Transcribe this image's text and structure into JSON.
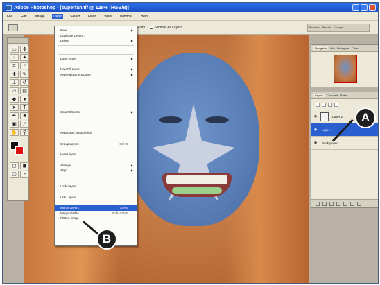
{
  "window": {
    "title": "Adobe Photoshop - [superfan.tif @ 128% (RGB/8)]"
  },
  "menubar": {
    "items": [
      "File",
      "Edit",
      "Image",
      "Layer",
      "Select",
      "Filter",
      "View",
      "Window",
      "Help"
    ],
    "active": "Layer"
  },
  "options_bar": {
    "opacity_label": "Opacity",
    "sample_label": "Sample All Layers",
    "well_tabs": [
      "Brushes",
      "Presets",
      "Comps"
    ]
  },
  "layer_menu": {
    "items": [
      {
        "label": "New",
        "submenu": true
      },
      {
        "label": "Duplicate Layers...",
        "submenu": false
      },
      {
        "label": "Delete",
        "submenu": true
      },
      {
        "label": "Layer Style",
        "submenu": true
      },
      {
        "label": "New Fill Layer",
        "submenu": true
      },
      {
        "label": "New Adjustment Layer",
        "submenu": true
      },
      {
        "label": "Smart Objects",
        "submenu": true
      },
      {
        "label": "New Layer Based Slice",
        "submenu": false
      },
      {
        "label": "Group Layers",
        "shortcut": "Ctrl+G"
      },
      {
        "label": "Hide Layers",
        "submenu": false
      },
      {
        "label": "Arrange",
        "submenu": true
      },
      {
        "label": "Align",
        "submenu": true
      },
      {
        "label": "Lock Layers...",
        "submenu": false
      },
      {
        "label": "Link Layers",
        "submenu": false
      },
      {
        "label": "Merge Layers",
        "shortcut": "Ctrl+E"
      },
      {
        "label": "Merge Visible",
        "shortcut": "Shift+Ctrl+E"
      },
      {
        "label": "Flatten Image",
        "shortcut": ""
      }
    ]
  },
  "navigator_panel": {
    "tabs": [
      "Navigator",
      "Info",
      "Histogram",
      "Color"
    ]
  },
  "layers_panel": {
    "tabs": [
      "Layers",
      "Channels",
      "Paths"
    ],
    "layers": [
      {
        "name": "Layer 2"
      },
      {
        "name": "Layer 1"
      },
      {
        "name": "Background"
      }
    ]
  },
  "callouts": {
    "a": "A",
    "b": "B"
  },
  "colors": {
    "highlight": "#2a5fd0",
    "titlebar": "#1a4fc2",
    "face_paint": "#5b80b8",
    "hair": "#c57a45"
  }
}
